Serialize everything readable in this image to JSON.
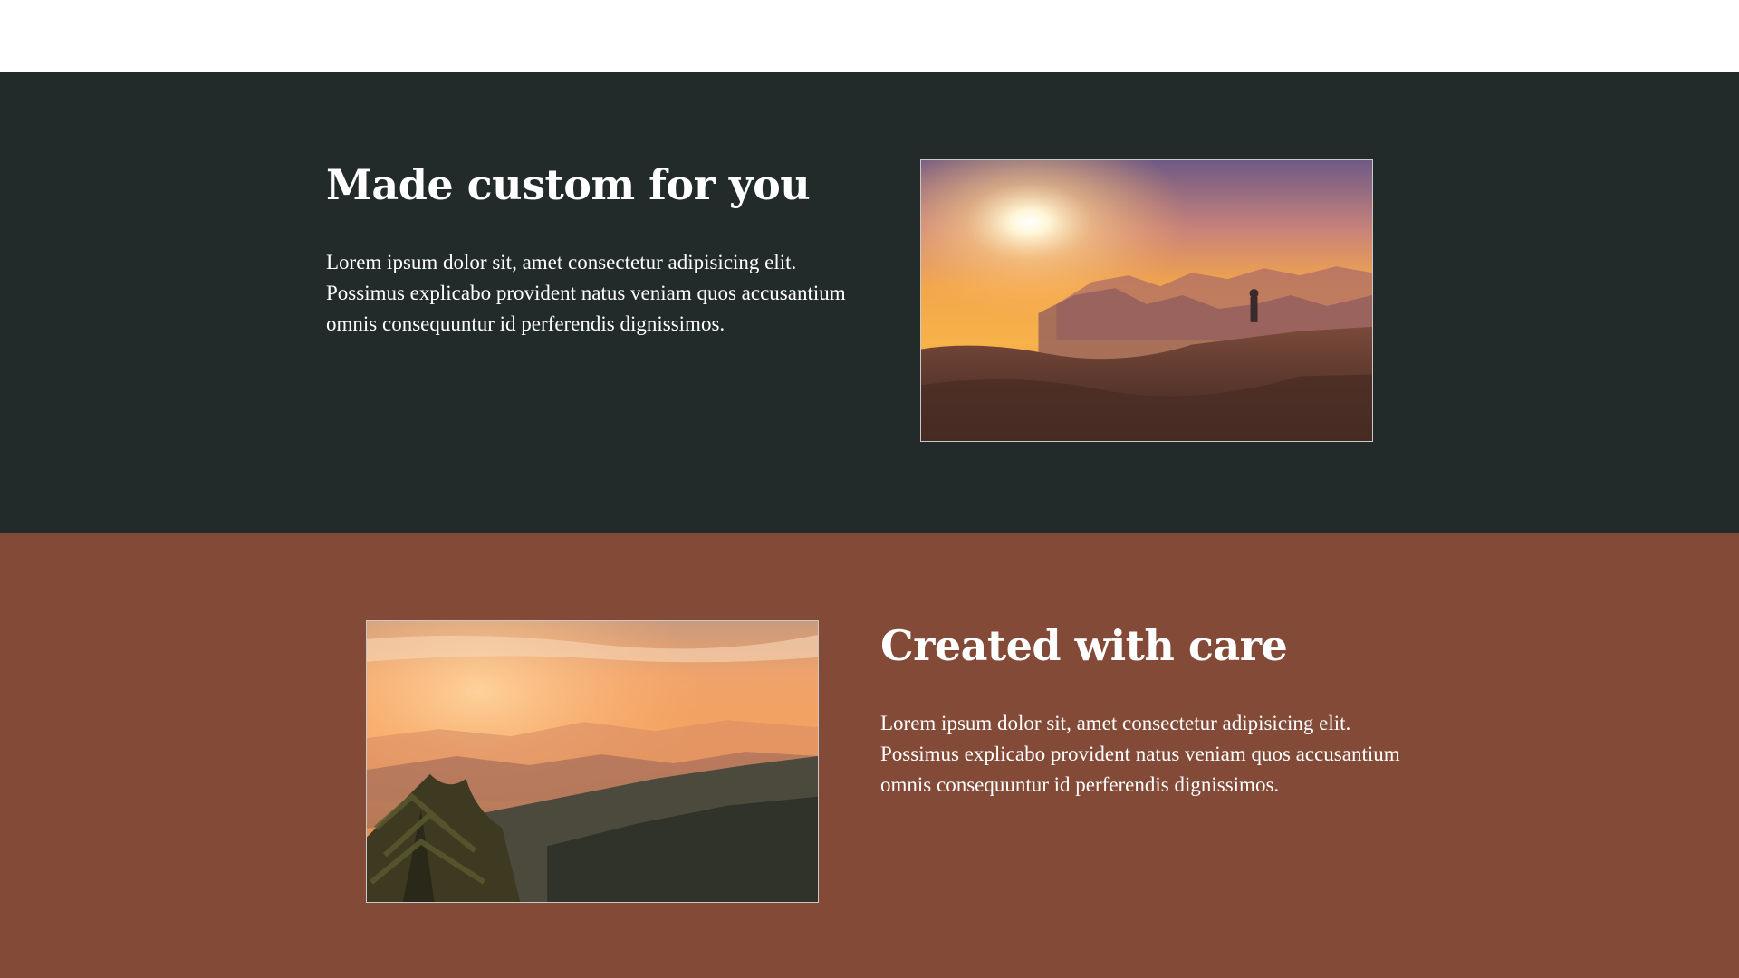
{
  "sections": [
    {
      "heading": "Made custom for you",
      "body": "Lorem ipsum dolor sit, amet consectetur adipisicing elit. Possimus explicabo provident natus veniam quos accusantium omnis consequuntur id perferendis dignissimos.",
      "background": "#222b2a"
    },
    {
      "heading": "Created with care",
      "body": "Lorem ipsum dolor sit, amet consectetur adipisicing elit. Possimus explicabo provident natus veniam quos accusantium omnis consequuntur id perferendis dignissimos.",
      "background": "#844a38"
    }
  ],
  "colors": {
    "text": "#ffffff",
    "top_bar": "#ffffff",
    "photo_border": "#c9c9c9"
  }
}
